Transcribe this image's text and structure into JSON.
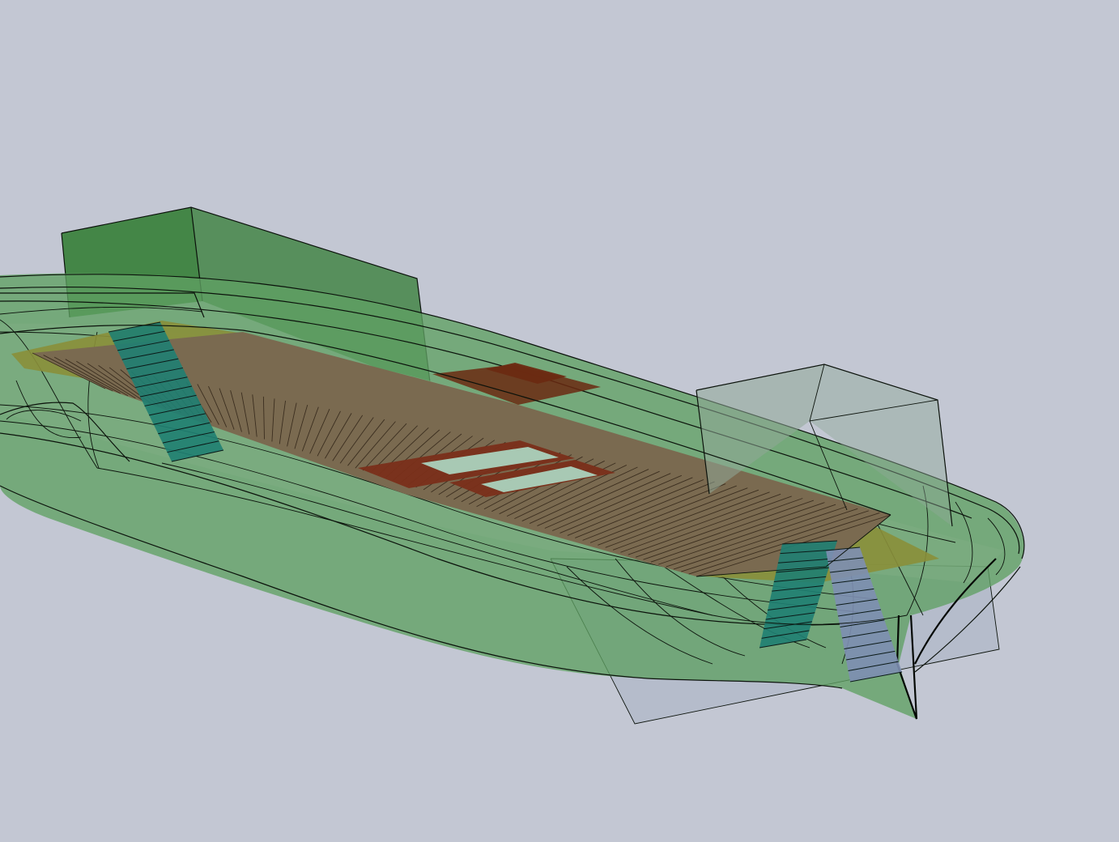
{
  "view": {
    "background_color": "#c3c7d3",
    "edge_color": "#0b120b"
  },
  "model": {
    "hull_color": "#5fa063",
    "hull_transparent_color": "#7fae83",
    "superstructure_color": "#2e7a2e",
    "forward_block_color": "#8fa897",
    "deck_plank_color": "#7a6a50",
    "deck_plank_edge_color": "#3b2e1f",
    "end_deck_color": "#8a8f3a",
    "hatch_frame_color": "#7a2f1a",
    "hatch_opening_color": "#a8c9b4",
    "hatch_block_color": "#6b2a12",
    "stair_color": "#1f7f72",
    "stair_blue_color": "#7e8fb3",
    "transom_plate_color": "#aab3c4"
  }
}
